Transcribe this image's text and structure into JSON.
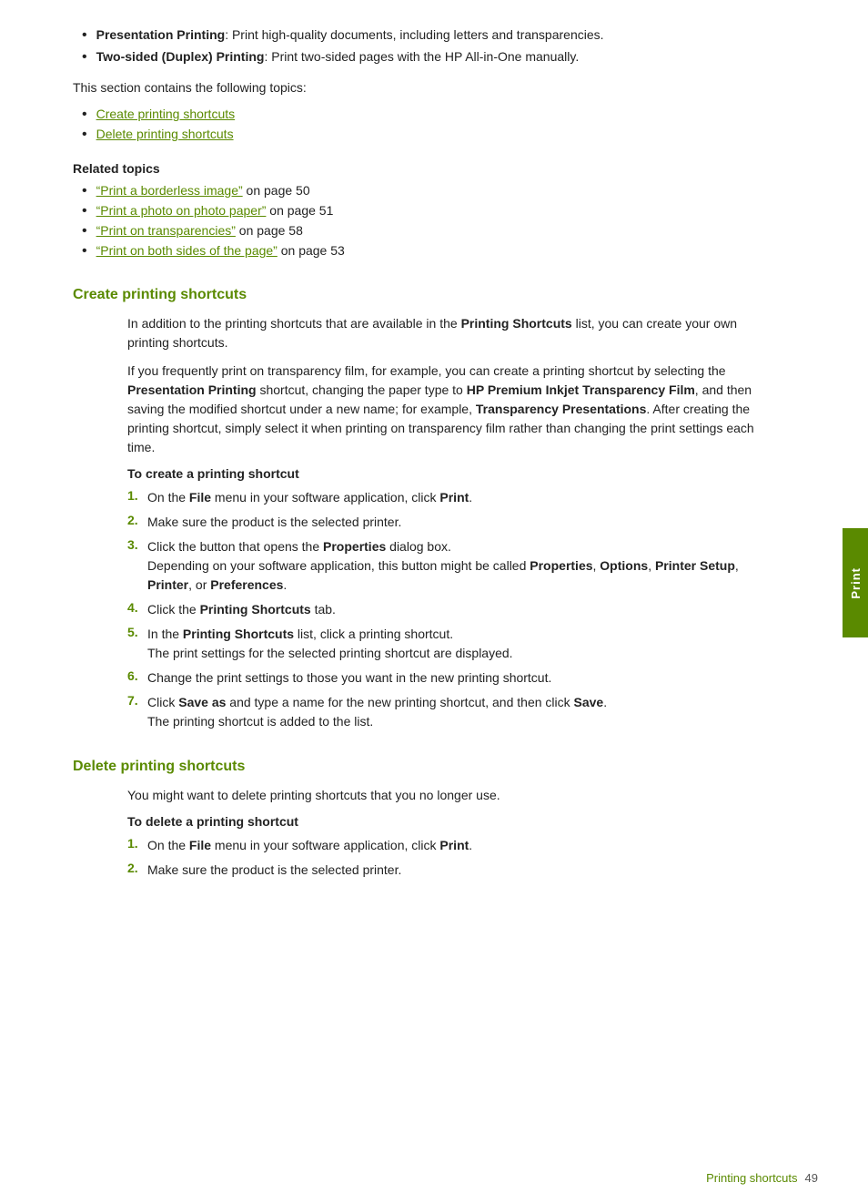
{
  "page": {
    "footer": {
      "section": "Printing shortcuts",
      "page_number": "49"
    },
    "right_tab_label": "Print"
  },
  "intro": {
    "bullets": [
      {
        "bold_part": "Presentation Printing",
        "rest": ": Print high-quality documents, including letters and transparencies."
      },
      {
        "bold_part": "Two-sided (Duplex) Printing",
        "rest": ": Print two-sided pages with the HP All-in-One manually."
      }
    ],
    "section_intro": "This section contains the following topics:",
    "topic_links": [
      "Create printing shortcuts",
      "Delete printing shortcuts"
    ]
  },
  "related_topics": {
    "title": "Related topics",
    "links": [
      {
        "text": "“Print a borderless image”",
        "suffix": " on page 50"
      },
      {
        "text": "“Print a photo on photo paper”",
        "suffix": " on page 51"
      },
      {
        "text": "“Print on transparencies”",
        "suffix": " on page 58"
      },
      {
        "text": "“Print on both sides of the page”",
        "suffix": " on page 53"
      }
    ]
  },
  "create_section": {
    "heading": "Create printing shortcuts",
    "para1": "In addition to the printing shortcuts that are available in the ",
    "para1_bold": "Printing Shortcuts",
    "para1_rest": " list, you can create your own printing shortcuts.",
    "para2_start": "If you frequently print on transparency film, for example, you can create a printing shortcut by selecting the ",
    "para2_b1": "Presentation Printing",
    "para2_mid": " shortcut, changing the paper type to ",
    "para2_b2": "HP Premium Inkjet Transparency Film",
    "para2_mid2": ", and then saving the modified shortcut under a new name; for example, ",
    "para2_b3": "Transparency Presentations",
    "para2_end": ". After creating the printing shortcut, simply select it when printing on transparency film rather than changing the print settings each time.",
    "sub_heading": "To create a printing shortcut",
    "steps": [
      {
        "num": "1.",
        "text": "On the ",
        "bold": "File",
        "rest": " menu in your software application, click ",
        "bold2": "Print",
        "end": "."
      },
      {
        "num": "2.",
        "text": "Make sure the product is the selected printer."
      },
      {
        "num": "3.",
        "text": "Click the button that opens the ",
        "bold": "Properties",
        "rest": " dialog box.",
        "sub": "Depending on your software application, this button might be called ",
        "sub_bold1": "Properties",
        "sub_rest1": ", ",
        "sub_bold2": "Options",
        "sub_rest2": ", ",
        "sub_bold3": "Printer Setup",
        "sub_rest3": ", ",
        "sub_bold4": "Printer",
        "sub_rest4": ", or ",
        "sub_bold5": "Preferences",
        "sub_rest5": "."
      },
      {
        "num": "4.",
        "text": "Click the ",
        "bold": "Printing Shortcuts",
        "rest": " tab."
      },
      {
        "num": "5.",
        "text": "In the ",
        "bold": "Printing Shortcuts",
        "rest": " list, click a printing shortcut.",
        "sub": "The print settings for the selected printing shortcut are displayed."
      },
      {
        "num": "6.",
        "text": "Change the print settings to those you want in the new printing shortcut."
      },
      {
        "num": "7.",
        "text": "Click ",
        "bold": "Save as",
        "rest": " and type a name for the new printing shortcut, and then click ",
        "bold2": "Save",
        "end": ".",
        "sub": "The printing shortcut is added to the list."
      }
    ]
  },
  "delete_section": {
    "heading": "Delete printing shortcuts",
    "para1": "You might want to delete printing shortcuts that you no longer use.",
    "sub_heading": "To delete a printing shortcut",
    "steps": [
      {
        "num": "1.",
        "text": "On the ",
        "bold": "File",
        "rest": " menu in your software application, click ",
        "bold2": "Print",
        "end": "."
      },
      {
        "num": "2.",
        "text": "Make sure the product is the selected printer."
      }
    ]
  }
}
